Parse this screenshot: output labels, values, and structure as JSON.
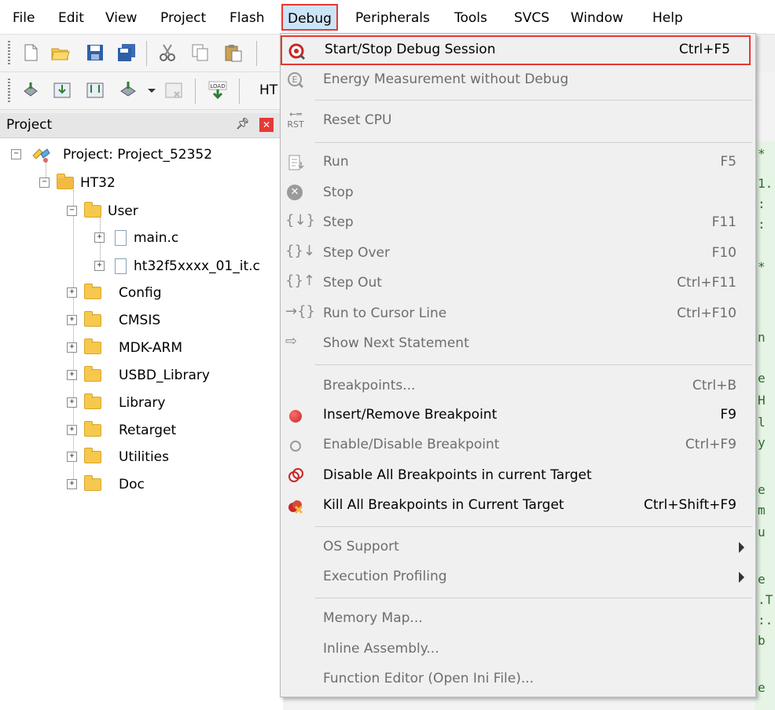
{
  "menubar": {
    "items": [
      "File",
      "Edit",
      "View",
      "Project",
      "Flash",
      "Debug",
      "Peripherals",
      "Tools",
      "SVCS",
      "Window",
      "Help"
    ],
    "active": "Debug"
  },
  "toolbar2": {
    "target_fragment": "HT"
  },
  "project_panel": {
    "title": "Project",
    "tree": [
      {
        "label": "Project: Project_52352"
      },
      {
        "label": "HT32"
      },
      {
        "label": "User"
      },
      {
        "label": "main.c"
      },
      {
        "label": "ht32f5xxxx_01_it.c"
      },
      {
        "label": "Config"
      },
      {
        "label": "CMSIS"
      },
      {
        "label": "MDK-ARM"
      },
      {
        "label": "USBD_Library"
      },
      {
        "label": "Library"
      },
      {
        "label": "Retarget"
      },
      {
        "label": "Utilities"
      },
      {
        "label": "Doc"
      }
    ]
  },
  "debug_menu": {
    "items": [
      {
        "label": "Start/Stop Debug Session",
        "shortcut": "Ctrl+F5",
        "icon": "debug-session-icon"
      },
      {
        "label": "Energy Measurement without Debug",
        "shortcut": "",
        "icon": "energy-icon"
      },
      {
        "label": "Reset CPU",
        "shortcut": "",
        "icon": "reset-cpu-icon",
        "icon_text": "RST"
      },
      {
        "label": "Run",
        "shortcut": "F5",
        "icon": "run-icon"
      },
      {
        "label": "Stop",
        "shortcut": "",
        "icon": "stop-icon"
      },
      {
        "label": "Step",
        "shortcut": "F11",
        "icon": "step-icon"
      },
      {
        "label": "Step Over",
        "shortcut": "F10",
        "icon": "step-over-icon"
      },
      {
        "label": "Step Out",
        "shortcut": "Ctrl+F11",
        "icon": "step-out-icon"
      },
      {
        "label": "Run to Cursor Line",
        "shortcut": "Ctrl+F10",
        "icon": "run-to-cursor-icon"
      },
      {
        "label": "Show Next Statement",
        "shortcut": "",
        "icon": "show-next-statement-icon"
      },
      {
        "label": "Breakpoints...",
        "shortcut": "Ctrl+B",
        "icon": ""
      },
      {
        "label": "Insert/Remove Breakpoint",
        "shortcut": "F9",
        "icon": "breakpoint-icon"
      },
      {
        "label": "Enable/Disable Breakpoint",
        "shortcut": "Ctrl+F9",
        "icon": "enable-breakpoint-icon"
      },
      {
        "label": "Disable All Breakpoints in current Target",
        "shortcut": "",
        "icon": "disable-all-breakpoints-icon"
      },
      {
        "label": "Kill All Breakpoints in Current Target",
        "shortcut": "Ctrl+Shift+F9",
        "icon": "kill-breakpoints-icon"
      },
      {
        "label": "OS Support",
        "shortcut": "",
        "icon": ""
      },
      {
        "label": "Execution Profiling",
        "shortcut": "",
        "icon": ""
      },
      {
        "label": "Memory Map...",
        "shortcut": "",
        "icon": ""
      },
      {
        "label": "Inline Assembly...",
        "shortcut": "",
        "icon": ""
      },
      {
        "label": "Function Editor (Open Ini File)...",
        "shortcut": "",
        "icon": ""
      }
    ]
  },
  "editor_fragments": [
    "*",
    "1.",
    ":",
    ":",
    "*",
    "n",
    "e",
    "H",
    "l",
    "y",
    "e",
    "m",
    "u",
    "e",
    ".T",
    ":.",
    "b",
    "e"
  ],
  "colors": {
    "highlight_border": "#e53935",
    "active_menu_bg": "#cce4f7"
  }
}
